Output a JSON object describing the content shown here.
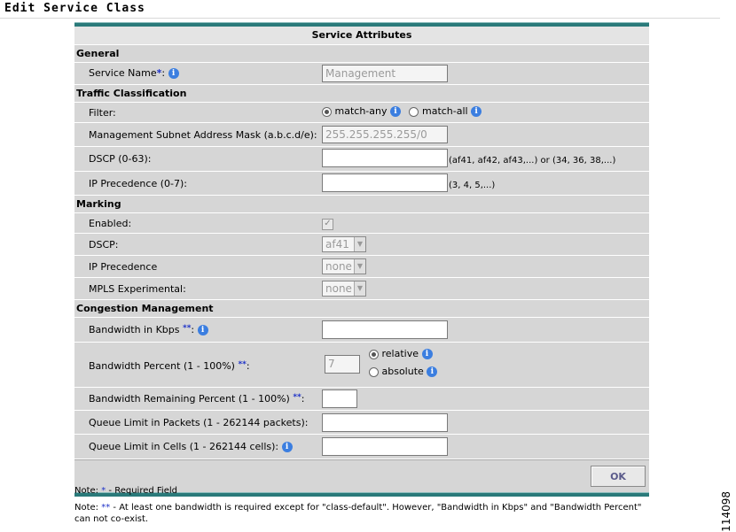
{
  "page": {
    "title": "Edit Service Class",
    "figure_id": "114098"
  },
  "form": {
    "header": "Service Attributes",
    "sections": {
      "general": "General",
      "traffic": "Traffic Classification",
      "marking": "Marking",
      "congestion": "Congestion Management"
    },
    "service_name": {
      "label": "Service Name",
      "req": "*",
      "value": "Management"
    },
    "filter": {
      "label": "Filter:",
      "opt_any": "match-any",
      "opt_all": "match-all",
      "selected": "match-any"
    },
    "mask": {
      "label": "Management Subnet Address Mask (a.b.c.d/e):",
      "value": "255.255.255.255/0"
    },
    "dscp_range": {
      "label": "DSCP (0-63):",
      "value": "",
      "hint": "(af41, af42, af43,...) or (34, 36, 38,...)"
    },
    "ipprec_range": {
      "label": "IP Precedence (0-7):",
      "value": "",
      "hint": "(3, 4, 5,...)"
    },
    "mark_enabled": {
      "label": "Enabled:",
      "checked": true
    },
    "mark_dscp": {
      "label": "DSCP:",
      "value": "af41"
    },
    "mark_ipprec": {
      "label": "IP Precedence",
      "value": "none"
    },
    "mark_mpls": {
      "label": "MPLS Experimental:",
      "value": "none"
    },
    "bw_kbps": {
      "label": "Bandwidth in Kbps",
      "req": "**",
      "value": ""
    },
    "bw_percent": {
      "label": "Bandwidth Percent (1  - 100%)",
      "req": "**",
      "value": "7",
      "opt_relative": "relative",
      "opt_absolute": "absolute",
      "selected": "relative"
    },
    "bw_remaining": {
      "label": "Bandwidth Remaining Percent (1  - 100%)",
      "req": "**",
      "value": ""
    },
    "queue_packets": {
      "label": "Queue Limit in Packets (1  - 262144 packets):",
      "value": ""
    },
    "queue_cells": {
      "label": "Queue Limit in Cells (1  - 262144 cells):",
      "value": ""
    },
    "ok_label": "OK",
    "info_glyph": "i",
    "colon": ":"
  },
  "notes": {
    "note1_prefix": "Note:",
    "note1_mark": "*",
    "note1_text": "- Required Field",
    "note2_prefix": "Note:",
    "note2_mark": "**",
    "note2_text": "- At least one bandwidth is required except for \"class-default\". However, \"Bandwidth in Kbps\" and \"Bandwidth Percent\" can not co-exist."
  },
  "colors": {
    "teal": "#2a7a7a",
    "panel": "#d6d6d6",
    "required": "#1f33c8",
    "info": "#3b7ee0"
  }
}
